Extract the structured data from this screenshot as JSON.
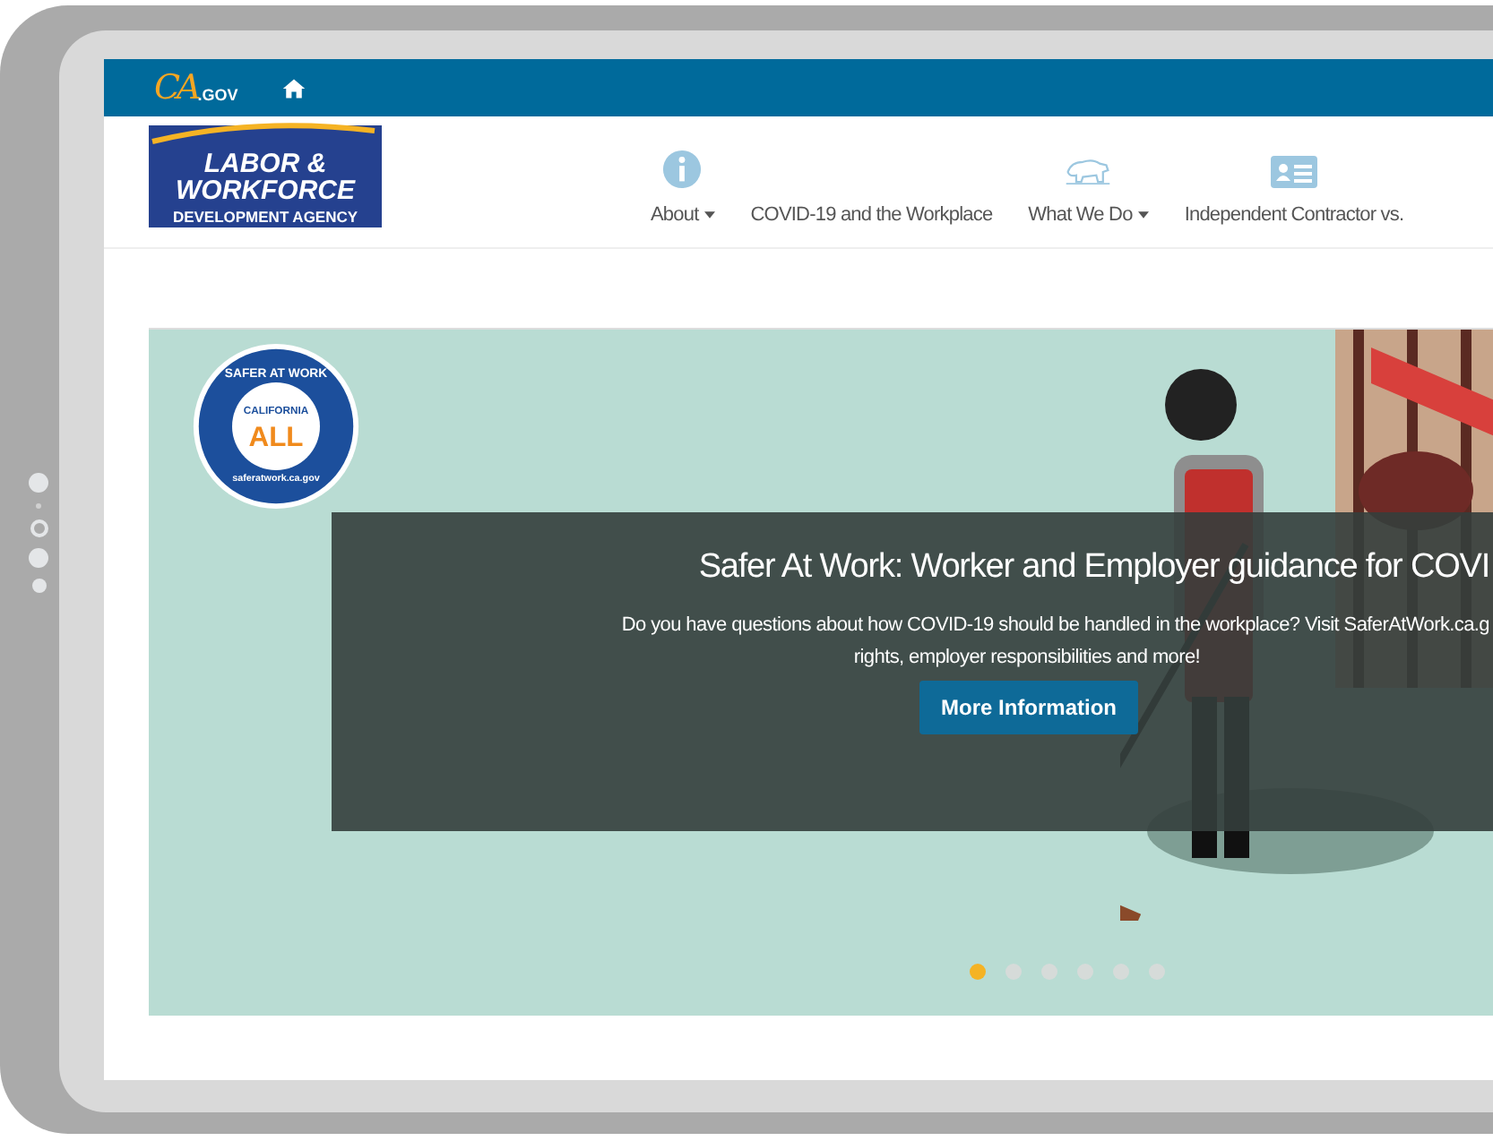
{
  "top_bar": {
    "logo_main": "CA",
    "logo_suffix": ".GOV"
  },
  "agency_logo": {
    "lines": [
      "LABOR &",
      "WORKFORCE",
      "DEVELOPMENT AGENCY"
    ]
  },
  "nav": [
    {
      "label": "About",
      "dropdown": true
    },
    {
      "label": "COVID-19 and the Workplace",
      "dropdown": false
    },
    {
      "label": "What We Do",
      "dropdown": true
    },
    {
      "label": "Independent Contractor vs.",
      "dropdown": false
    }
  ],
  "hero": {
    "badge": {
      "top": "SAFER AT WORK",
      "state": "CALIFORNIA",
      "word": "ALL",
      "url": "saferatwork.ca.gov"
    },
    "title": "Safer At Work: Worker and Employer guidance for COVI",
    "lines": [
      "Do you have questions about how COVID-19 should be handled in the workplace? Visit SaferAtWork.ca.g",
      "rights, employer responsibilities and more!"
    ],
    "button": "More Information",
    "dots": [
      {
        "selected": true
      },
      {
        "selected": false
      },
      {
        "selected": false
      },
      {
        "selected": false
      },
      {
        "selected": false
      },
      {
        "selected": false
      }
    ]
  }
}
